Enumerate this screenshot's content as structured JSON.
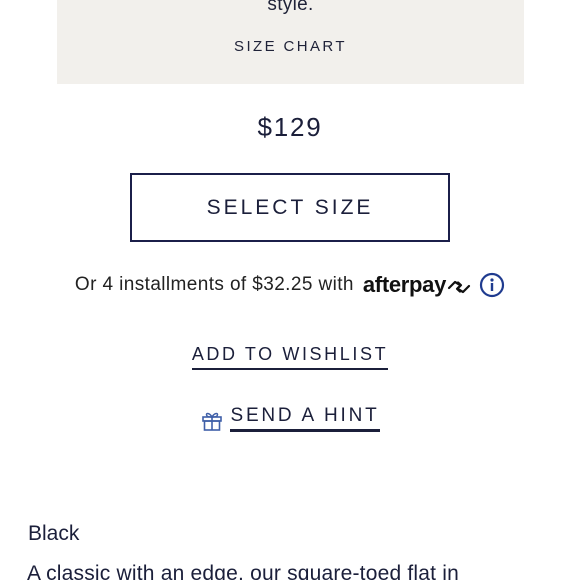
{
  "size_panel": {
    "fit_text": "style.",
    "size_chart_label": "SIZE CHART"
  },
  "price": "$129",
  "select_size_label": "SELECT SIZE",
  "installments": {
    "text": "Or 4 installments of $32.25 with",
    "provider": "afterpay"
  },
  "wishlist_label": "ADD TO WISHLIST",
  "hint_label": "SEND A HINT",
  "color_name": "Black",
  "description": "A classic with an edge, our square-toed flat in",
  "colors": {
    "navy": "#1b1f3a",
    "panel_bg": "#f2f0ec",
    "info_blue": "#1f3b8f"
  }
}
